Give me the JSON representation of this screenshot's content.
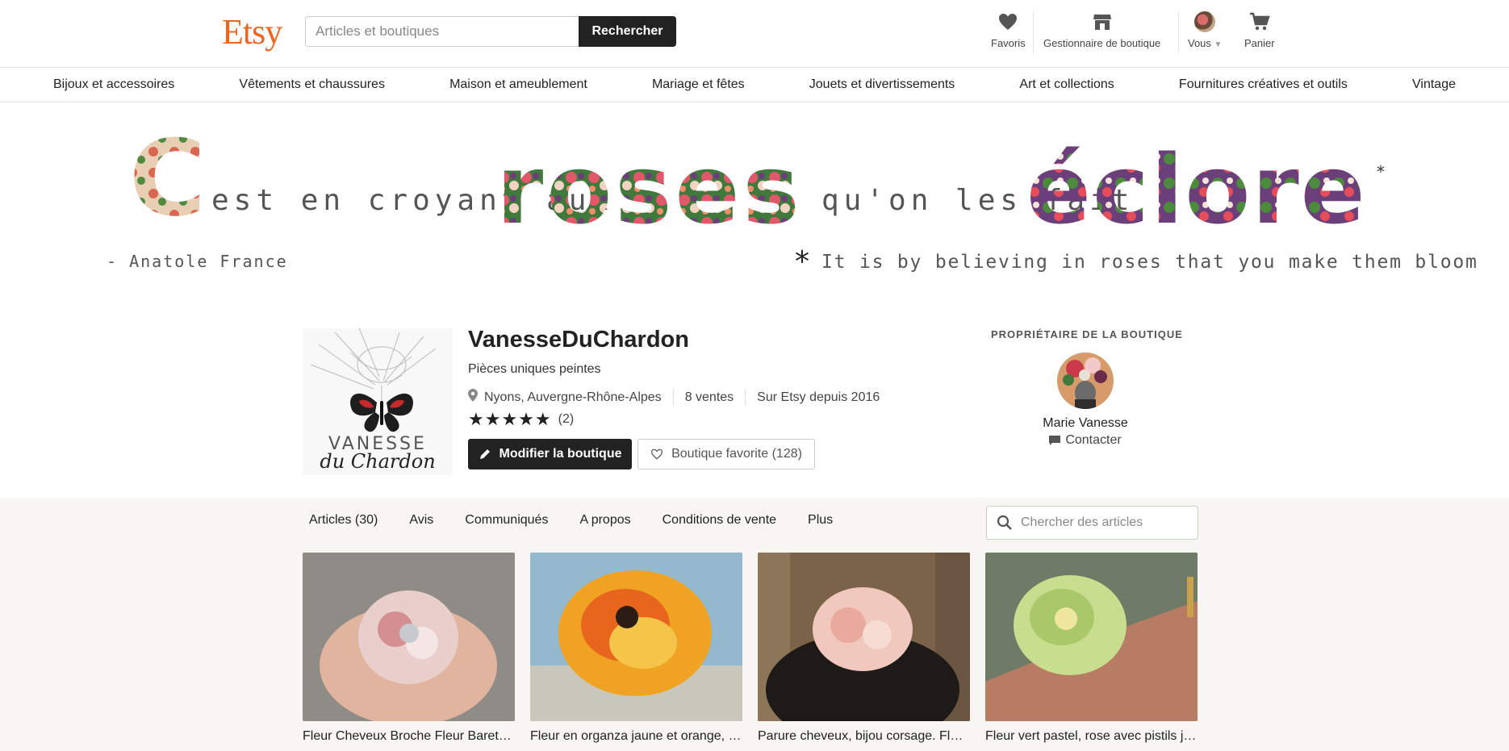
{
  "header": {
    "logo": "Etsy",
    "search_placeholder": "Articles et boutiques",
    "search_button": "Rechercher",
    "nav": [
      {
        "label": "Favoris",
        "icon": "heart-icon"
      },
      {
        "label": "Gestionnaire de boutique",
        "icon": "shop-icon"
      },
      {
        "label": "Vous",
        "icon": "avatar"
      },
      {
        "label": "Panier",
        "icon": "cart-icon"
      }
    ]
  },
  "categories": [
    "Bijoux et accessoires",
    "Vêtements et chaussures",
    "Maison et ameublement",
    "Mariage et fêtes",
    "Jouets et divertissements",
    "Art et collections",
    "Fournitures créatives et outils",
    "Vintage"
  ],
  "banner": {
    "line1_a": "C",
    "line1_b": "est en croyant aux",
    "line1_c": "roses",
    "line1_d": "qu'on les fait",
    "line1_e": "éclore",
    "asterisk": "*",
    "author": "- Anatole France",
    "translation_star": "*",
    "translation": "It is by believing in roses that you make them bloom"
  },
  "shop": {
    "logo_text_1": "VANESSE",
    "logo_text_2": "du Chardon",
    "name": "VanesseDuChardon",
    "tagline": "Pièces uniques peintes",
    "location": "Nyons, Auvergne-Rhône-Alpes",
    "sales": "8 ventes",
    "since": "Sur Etsy depuis 2016",
    "rating": 5,
    "stars": "★★★★★",
    "reviews": "(2)",
    "edit_button": "Modifier la boutique",
    "fav_button": "Boutique favorite (128)"
  },
  "owner": {
    "heading": "PROPRIÉTAIRE DE LA BOUTIQUE",
    "name": "Marie Vanesse",
    "contact": "Contacter"
  },
  "tabs": [
    "Articles (30)",
    "Avis",
    "Communiqués",
    "A propos",
    "Conditions de vente",
    "Plus"
  ],
  "item_search_placeholder": "Chercher des articles",
  "listings": [
    {
      "title": "Fleur Cheveux Broche Fleur Barette Fleur Bijou",
      "colors": [
        "#9b9690",
        "#e7c9c5"
      ]
    },
    {
      "title": "Fleur en organza jaune et orange, broche fleur",
      "colors": [
        "#8fb8cc",
        "#f1a72a"
      ]
    },
    {
      "title": "Parure cheveux, bijou corsage. Fleur en soie rose",
      "colors": [
        "#6e5a44",
        "#efc9bd"
      ]
    },
    {
      "title": "Fleur vert pastel, rose avec pistils jaunes",
      "colors": [
        "#7a8a70",
        "#c9dd8f"
      ]
    }
  ]
}
